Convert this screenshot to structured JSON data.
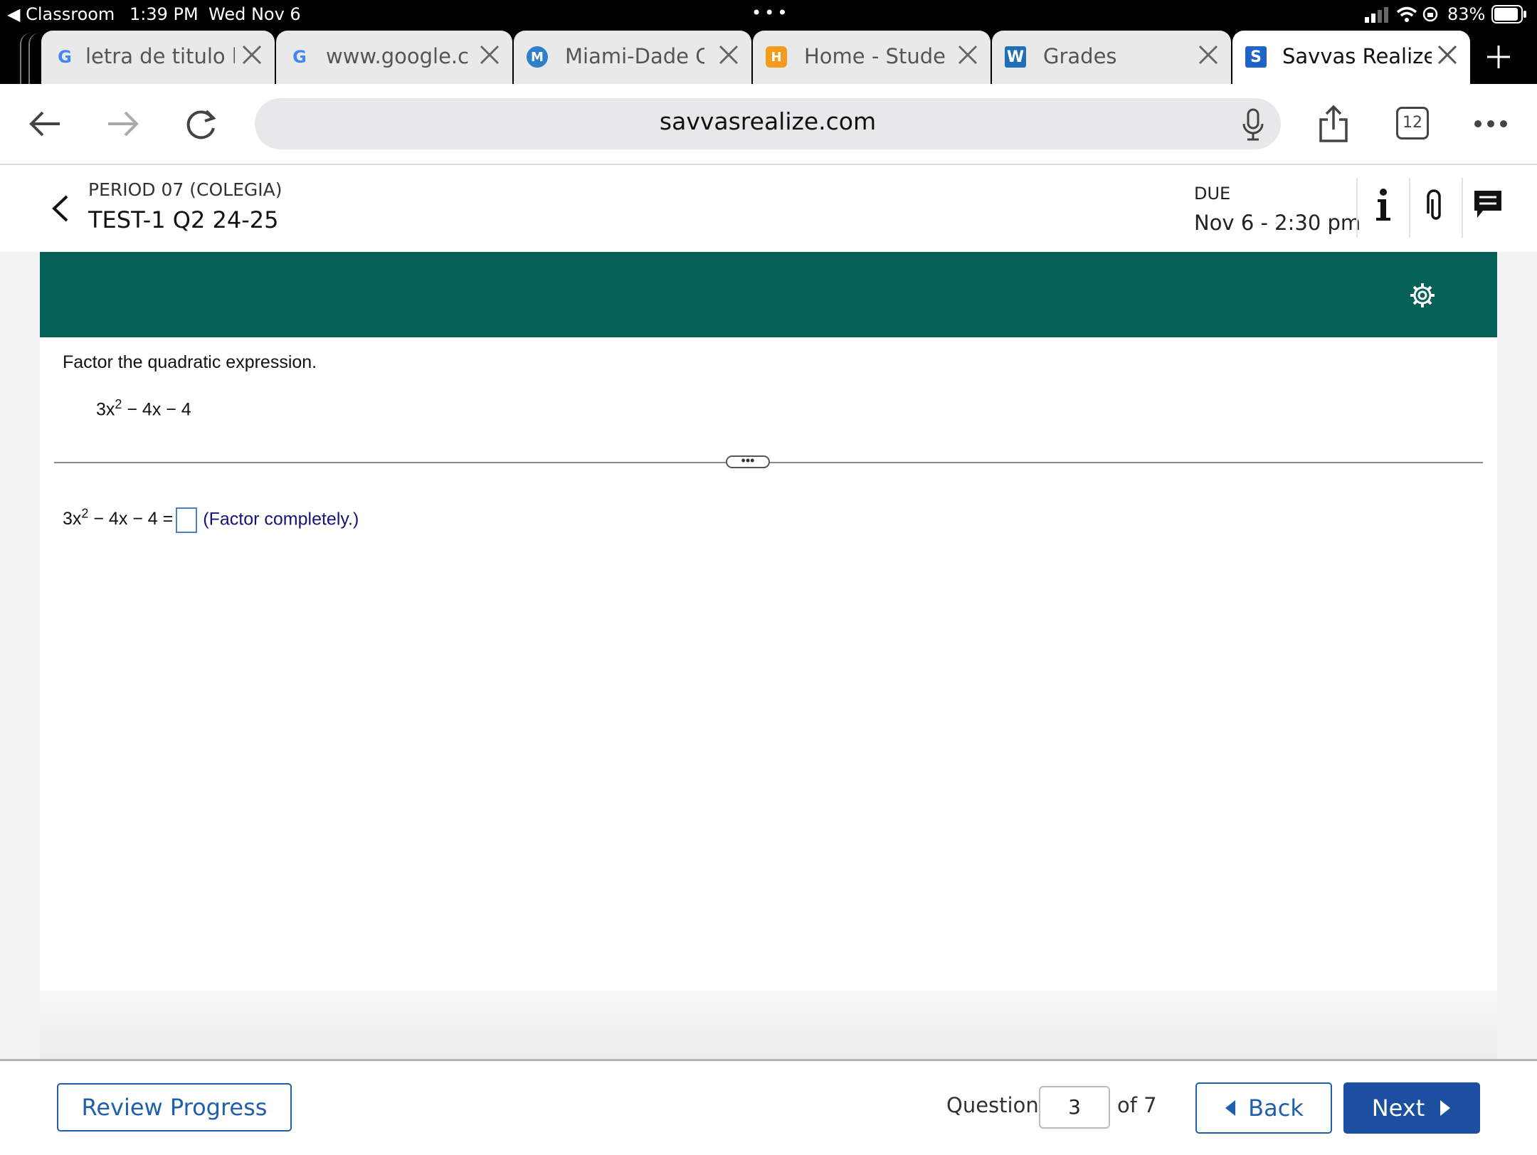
{
  "status_bar": {
    "back_app": "◀ Classroom",
    "time": "1:39 PM",
    "date": "Wed Nov 6",
    "battery": "83%"
  },
  "tabs": [
    {
      "title": "letra de titulo b",
      "favicon": "G",
      "favicon_color": "#4285f4"
    },
    {
      "title": "www.google.co",
      "favicon": "G",
      "favicon_color": "#4285f4"
    },
    {
      "title": "Miami-Dade Co",
      "favicon": "M",
      "favicon_color": "#2f80c9"
    },
    {
      "title": "Home - Studen",
      "favicon": "H",
      "favicon_color": "#f29b1d"
    },
    {
      "title": "Grades",
      "favicon": "W",
      "favicon_color": "#1d6fb8"
    },
    {
      "title": "Savvas Realize",
      "favicon": "S",
      "favicon_color": "#1e64c8"
    }
  ],
  "address_bar": {
    "url": "savvasrealize.com",
    "tab_count": "12"
  },
  "header": {
    "period": "PERIOD 07 (COLEGIA)",
    "title": "TEST-1 Q2 24-25",
    "due_label": "DUE",
    "due_date": "Nov 6 - 2:30 pm"
  },
  "question": {
    "prompt": "Factor the quadratic expression.",
    "expr_base": "3x",
    "expr_exp": "2",
    "expr_rest": " − 4x − 4",
    "answer_base": "3x",
    "answer_exp": "2",
    "answer_rest": " − 4x − 4 =",
    "hint": "(Factor completely.)"
  },
  "footer": {
    "review_label": "Review Progress",
    "question_label": "Question",
    "question_number": "3",
    "of_label": "of 7",
    "back_label": "Back",
    "next_label": "Next"
  },
  "colors": {
    "banner": "#056157",
    "primary": "#1c4fa0"
  }
}
